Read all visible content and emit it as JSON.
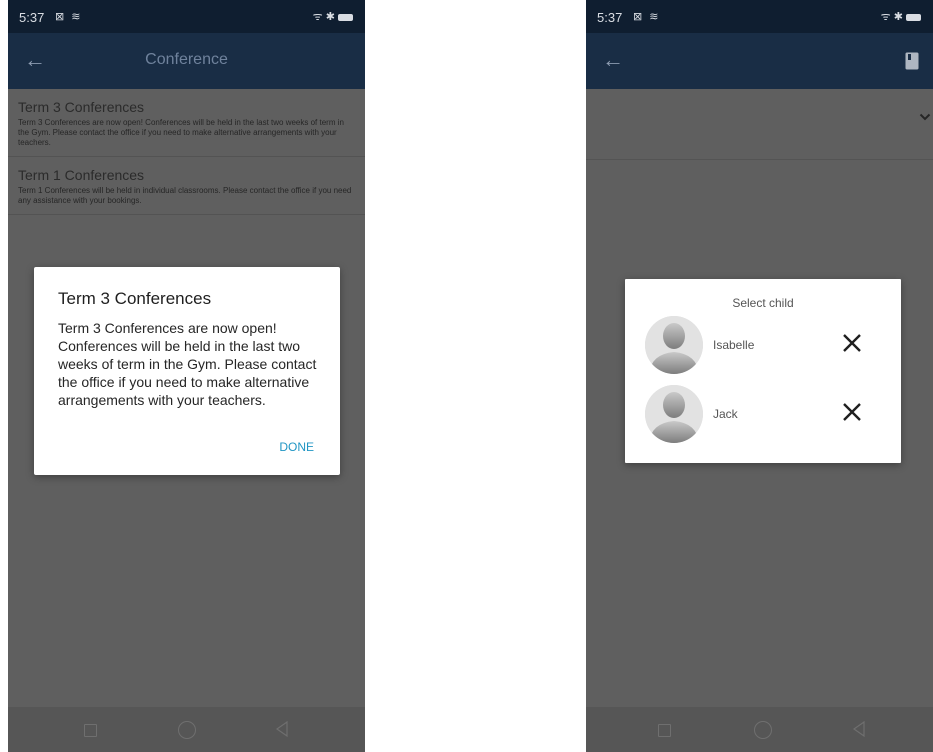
{
  "left_screen": {
    "status": {
      "time": "5:37",
      "left_icons": "⊠ ≋",
      "right_icons": "ᯤ ✱"
    },
    "toolbar": {
      "title": "Conference",
      "back_icon": "arrow-left-icon"
    },
    "conferences": [
      {
        "title": "Term 3 Conferences",
        "description": "Term 3 Conferences are now open! Conferences will be held in the last two weeks of term in the Gym. Please contact the office if you need to make alternative arrangements with your teachers."
      },
      {
        "title": "Term 1 Conferences",
        "description": "Term 1 Conferences will be held in individual classrooms. Please contact the office if you need any assistance with your bookings."
      }
    ],
    "dialog": {
      "title": "Term 3 Conferences",
      "body": "Term 3 Conferences are now open! Conferences will be held in the last two weeks of term in the Gym. Please contact the office if you need to make alternative arrangements with your teachers.",
      "done_label": "DONE"
    }
  },
  "right_screen": {
    "status": {
      "time": "5:37",
      "left_icons": "⊠ ≋",
      "right_icons": "ᯤ ✱"
    },
    "toolbar": {
      "back_icon": "arrow-left-icon",
      "action_icon": "book-icon"
    },
    "dialog": {
      "title": "Select child",
      "children": [
        {
          "name": "Isabelle"
        },
        {
          "name": "Jack"
        }
      ]
    }
  },
  "colors": {
    "status_bar": "#0f1e30",
    "toolbar": "#192d45",
    "overlay_bg": "#5f5f5f",
    "accent": "#2196c4"
  }
}
